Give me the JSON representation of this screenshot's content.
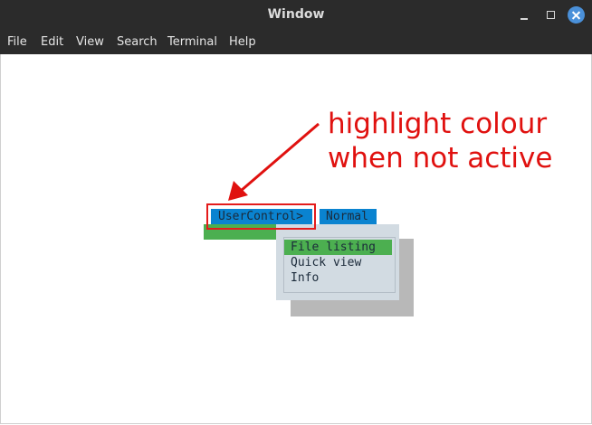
{
  "window": {
    "title": "Window"
  },
  "menubar": {
    "items": [
      "File",
      "Edit",
      "View",
      "Search",
      "Terminal",
      "Help"
    ]
  },
  "tabs": {
    "usercontrol": "UserControl>",
    "normal": "Normal"
  },
  "popup": {
    "items": [
      "File listing",
      "Quick view",
      "Info"
    ],
    "selected_index": 0
  },
  "annotation": {
    "line1": "highlight colour",
    "line2": "when not active"
  },
  "colors": {
    "tab_highlight": "#0a83d0",
    "selection": "#4caf50",
    "annotation": "#e0110f",
    "popup_bg": "#d2dbe2"
  }
}
